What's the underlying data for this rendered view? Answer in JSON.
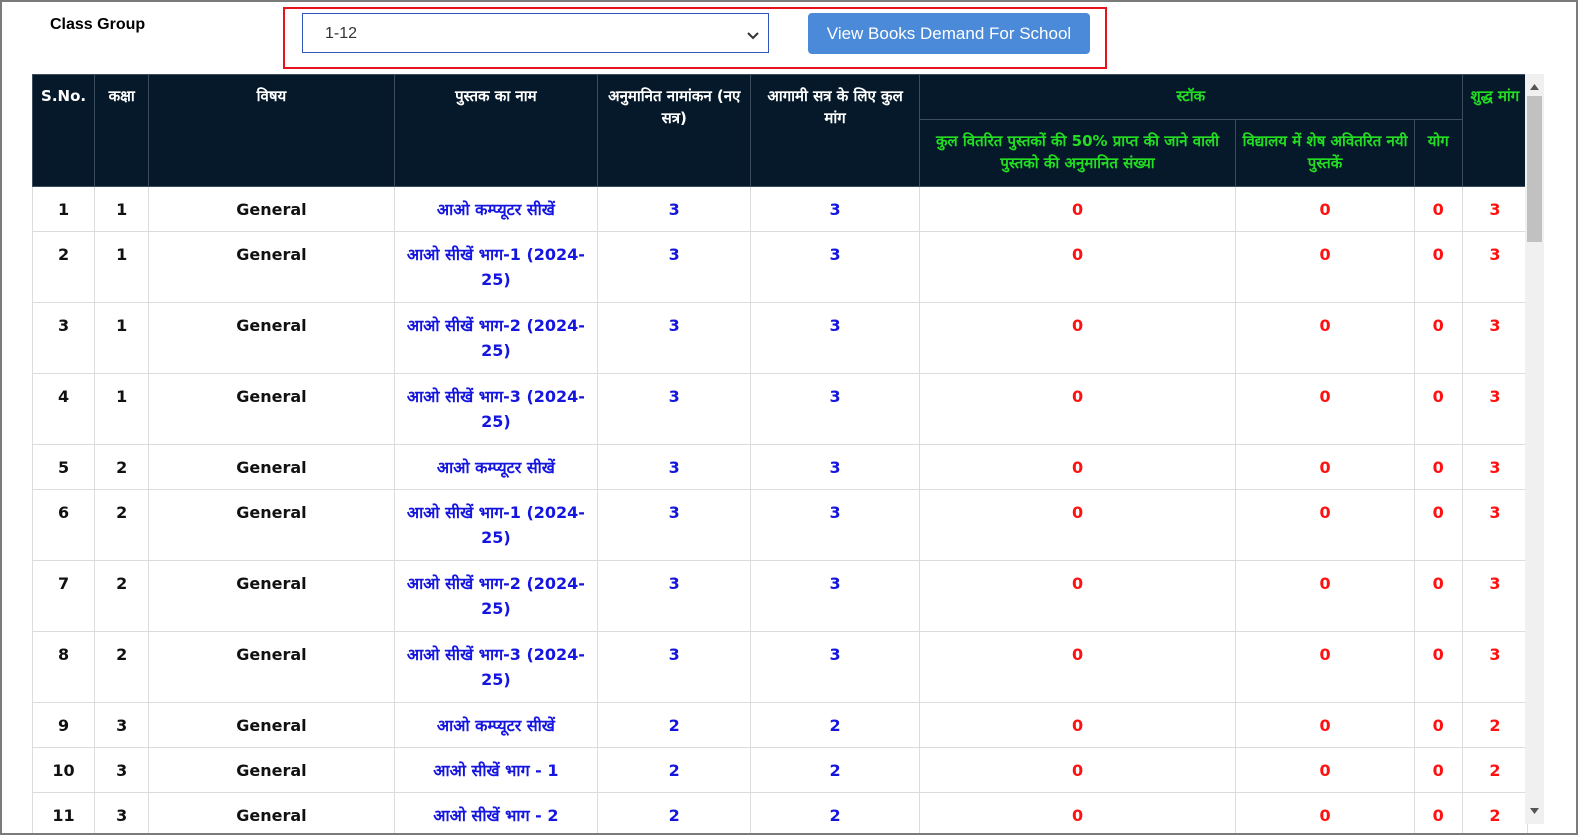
{
  "filter": {
    "label": "Class Group",
    "selected": "1-12",
    "button_label": "View Books Demand For School"
  },
  "table": {
    "headers": {
      "sno": "S.No.",
      "class": "कक्षा",
      "subject": "विषय",
      "book_name": "पुस्तक का नाम",
      "estimated_enrollment": "अनुमानित नामांकन (नए सत्र)",
      "total_demand": "आगामी सत्र के लिए कुल मांग",
      "stock": "स्टॉक",
      "stock_expected": "कुल वितरित पुस्तकों की 50% प्राप्त की जाने वाली पुस्तको की अनुमानित संख्या",
      "stock_remaining": "विद्यालय में शेष अवितरित नयी पुस्तकें",
      "stock_total": "योग",
      "net_demand": "शुद्ध मांग"
    },
    "rows": [
      {
        "sno": "1",
        "class": "1",
        "subject": "General",
        "book": "आओ कम्प्यूटर सीखें",
        "enroll": "3",
        "demand": "3",
        "expected": "0",
        "remaining": "0",
        "total": "0",
        "net": "3"
      },
      {
        "sno": "2",
        "class": "1",
        "subject": "General",
        "book": "आओ सीखें भाग-1 (2024-25)",
        "enroll": "3",
        "demand": "3",
        "expected": "0",
        "remaining": "0",
        "total": "0",
        "net": "3"
      },
      {
        "sno": "3",
        "class": "1",
        "subject": "General",
        "book": "आओ सीखें भाग-2 (2024-25)",
        "enroll": "3",
        "demand": "3",
        "expected": "0",
        "remaining": "0",
        "total": "0",
        "net": "3"
      },
      {
        "sno": "4",
        "class": "1",
        "subject": "General",
        "book": "आओ सीखें भाग-3 (2024-25)",
        "enroll": "3",
        "demand": "3",
        "expected": "0",
        "remaining": "0",
        "total": "0",
        "net": "3"
      },
      {
        "sno": "5",
        "class": "2",
        "subject": "General",
        "book": "आओ कम्प्यूटर सीखें",
        "enroll": "3",
        "demand": "3",
        "expected": "0",
        "remaining": "0",
        "total": "0",
        "net": "3"
      },
      {
        "sno": "6",
        "class": "2",
        "subject": "General",
        "book": "आओ सीखें भाग-1 (2024-25)",
        "enroll": "3",
        "demand": "3",
        "expected": "0",
        "remaining": "0",
        "total": "0",
        "net": "3"
      },
      {
        "sno": "7",
        "class": "2",
        "subject": "General",
        "book": "आओ सीखें भाग-2 (2024-25)",
        "enroll": "3",
        "demand": "3",
        "expected": "0",
        "remaining": "0",
        "total": "0",
        "net": "3"
      },
      {
        "sno": "8",
        "class": "2",
        "subject": "General",
        "book": "आओ सीखें भाग-3 (2024-25)",
        "enroll": "3",
        "demand": "3",
        "expected": "0",
        "remaining": "0",
        "total": "0",
        "net": "3"
      },
      {
        "sno": "9",
        "class": "3",
        "subject": "General",
        "book": "आओ कम्प्यूटर सीखें",
        "enroll": "2",
        "demand": "2",
        "expected": "0",
        "remaining": "0",
        "total": "0",
        "net": "2"
      },
      {
        "sno": "10",
        "class": "3",
        "subject": "General",
        "book": "आओ सीखें भाग - 1",
        "enroll": "2",
        "demand": "2",
        "expected": "0",
        "remaining": "0",
        "total": "0",
        "net": "2"
      },
      {
        "sno": "11",
        "class": "3",
        "subject": "General",
        "book": "आओ सीखें भाग - 2",
        "enroll": "2",
        "demand": "2",
        "expected": "0",
        "remaining": "0",
        "total": "0",
        "net": "2"
      }
    ]
  },
  "colors": {
    "header_bg": "#06192a",
    "header_text": "#ffffff",
    "header_green": "#22dd22",
    "blue_text": "#1515e0",
    "red_text": "#ff1111",
    "highlight_border": "#e8121c",
    "button_bg": "#4a8ad8"
  },
  "icons": {
    "select_chevron": "chevron-down-icon",
    "scroll_up": "scroll-up-arrow-icon",
    "scroll_down": "scroll-down-arrow-icon"
  }
}
